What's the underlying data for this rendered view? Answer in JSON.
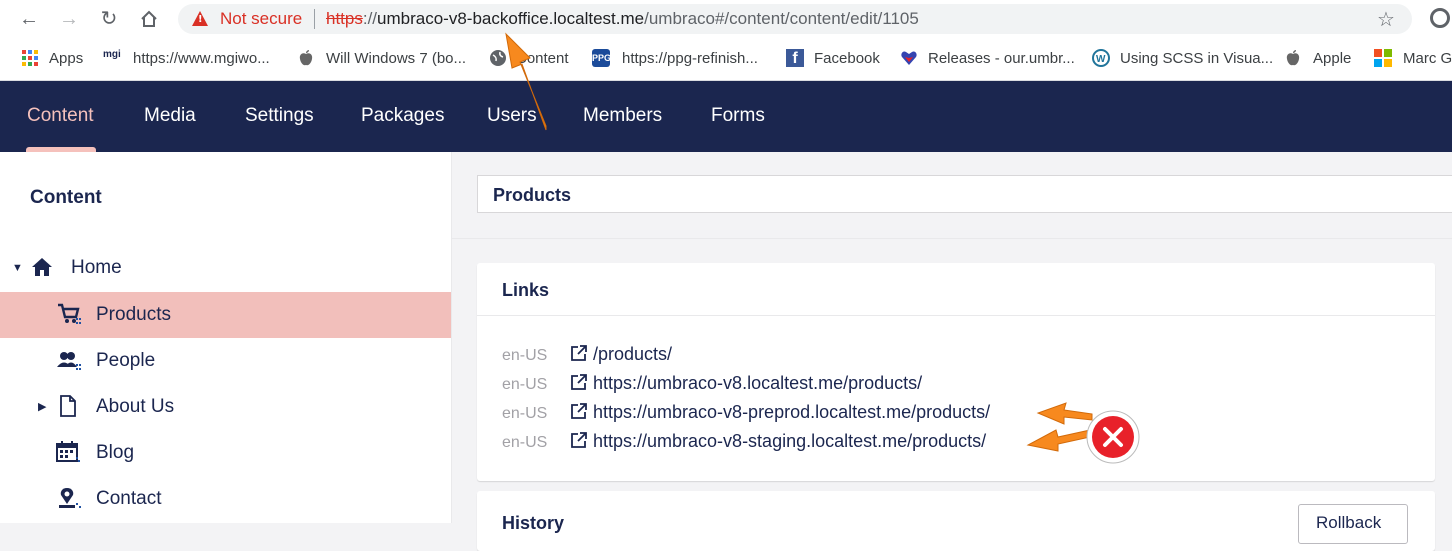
{
  "browser": {
    "security_label": "Not secure",
    "url_scheme": "https",
    "url_sep": "://",
    "url_host": "umbraco-v8-backoffice.localtest.me",
    "url_path": "/umbraco#/content/content/edit/1105"
  },
  "bookmarks": [
    {
      "label": "Apps",
      "icon": "apps-grid-icon"
    },
    {
      "label": "https://www.mgiwo...",
      "icon": "mgi-icon"
    },
    {
      "label": "Will Windows 7 (bo...",
      "icon": "apple-icon"
    },
    {
      "label": "Content",
      "icon": "globe-icon"
    },
    {
      "label": "https://ppg-refinish...",
      "icon": "ppg-icon"
    },
    {
      "label": "Facebook",
      "icon": "facebook-icon"
    },
    {
      "label": "Releases - our.umbr...",
      "icon": "umbraco-heart-icon"
    },
    {
      "label": "Using SCSS in Visua...",
      "icon": "wordpress-icon"
    },
    {
      "label": "Apple",
      "icon": "apple-icon"
    },
    {
      "label": "Marc G",
      "icon": "microsoft-icon"
    }
  ],
  "sections": [
    "Content",
    "Media",
    "Settings",
    "Packages",
    "Users",
    "Members",
    "Forms"
  ],
  "tree": {
    "title": "Content",
    "items": [
      {
        "label": "Home",
        "icon": "home-icon"
      },
      {
        "label": "Products",
        "icon": "cart-icon"
      },
      {
        "label": "People",
        "icon": "people-icon"
      },
      {
        "label": "About Us",
        "icon": "document-icon"
      },
      {
        "label": "Blog",
        "icon": "calendar-icon"
      },
      {
        "label": "Contact",
        "icon": "map-pin-icon"
      }
    ]
  },
  "editor": {
    "node_name": "Products",
    "links_title": "Links",
    "links": [
      {
        "culture": "en-US",
        "url": "/products/"
      },
      {
        "culture": "en-US",
        "url": "https://umbraco-v8.localtest.me/products/"
      },
      {
        "culture": "en-US",
        "url": "https://umbraco-v8-preprod.localtest.me/products/"
      },
      {
        "culture": "en-US",
        "url": "https://umbraco-v8-staging.localtest.me/products/"
      }
    ],
    "history_title": "History",
    "rollback_label": "Rollback"
  },
  "colors": {
    "header_bg": "#1b264f",
    "accent": "#f5c1bc",
    "selected_row": "#f2bfbb",
    "annotation_arrow": "#f7891e",
    "annotation_error": "#e8212a"
  }
}
